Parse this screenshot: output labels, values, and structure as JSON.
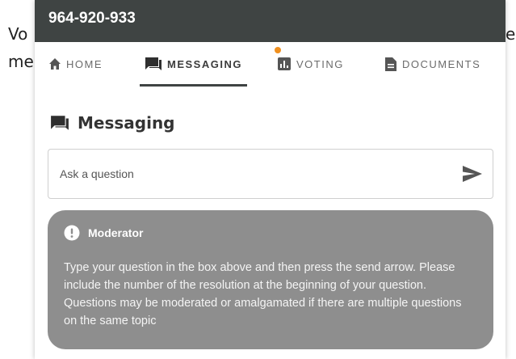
{
  "background": {
    "left_line1": "Vo",
    "left_line2": "me",
    "right_line1": "e",
    "right_line2": ""
  },
  "header": {
    "title": "964-920-933"
  },
  "nav": {
    "tabs": [
      {
        "label": "Home",
        "icon": "home-icon"
      },
      {
        "label": "Messaging",
        "icon": "chat-icon"
      },
      {
        "label": "Voting",
        "icon": "bar-chart-icon"
      },
      {
        "label": "Documents",
        "icon": "document-icon"
      }
    ]
  },
  "messaging": {
    "title": "Messaging",
    "input_placeholder": "Ask a question"
  },
  "moderator": {
    "name": "Moderator",
    "message": "Type your question in the box above and then press the send arrow. Please include the number of the resolution at the beginning of your question. Questions may be moderated or amalgamated if there are multiple questions on the same topic"
  },
  "colors": {
    "topbar": "#3f4443",
    "moderator_bg": "#8e8e8e",
    "notification_dot": "#f0901f"
  }
}
